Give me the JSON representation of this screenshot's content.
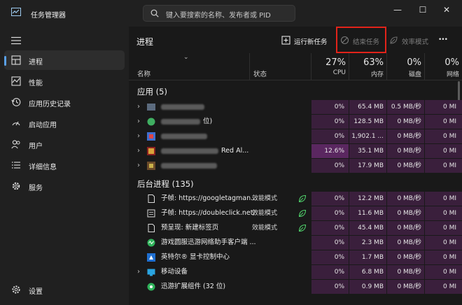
{
  "window": {
    "title": "任务管理器",
    "search_placeholder": "键入要搜索的名称、发布者或 PID",
    "controls": {
      "minimize": "—",
      "maximize": "☐",
      "close": "✕"
    }
  },
  "sidebar": {
    "items": [
      {
        "label": "进程",
        "icon": "processes-icon",
        "active": true
      },
      {
        "label": "性能",
        "icon": "performance-icon"
      },
      {
        "label": "应用历史记录",
        "icon": "app-history-icon"
      },
      {
        "label": "启动应用",
        "icon": "startup-icon"
      },
      {
        "label": "用户",
        "icon": "users-icon"
      },
      {
        "label": "详细信息",
        "icon": "details-icon"
      },
      {
        "label": "服务",
        "icon": "services-icon"
      }
    ],
    "settings_label": "设置"
  },
  "toolbar": {
    "title": "进程",
    "run_new_task": "运行新任务",
    "end_task": "结束任务",
    "efficiency_mode": "效率模式",
    "more": "•••"
  },
  "columns": {
    "name": "名称",
    "status": "状态",
    "cpu_pct": "27%",
    "cpu_label": "CPU",
    "mem_pct": "63%",
    "mem_label": "内存",
    "disk_pct": "0%",
    "disk_label": "磁盘",
    "net_pct": "0%",
    "net_label": "网络"
  },
  "sections": {
    "apps": "应用 (5)",
    "background": "后台进程 (135)"
  },
  "apps": [
    {
      "name": "",
      "cpu": "0%",
      "mem": "65.4 MB",
      "disk": "0.5 MB/秒",
      "net": "0 MI"
    },
    {
      "name": "位)",
      "cpu": "0%",
      "mem": "128.5 MB",
      "disk": "0 MB/秒",
      "net": "0 MI"
    },
    {
      "name": "",
      "cpu": "0%",
      "mem": "1,902.1 ...",
      "disk": "0 MB/秒",
      "net": "0 MI"
    },
    {
      "name": "Red Al...",
      "cpu": "12.6%",
      "mem": "35.1 MB",
      "disk": "0 MB/秒",
      "net": "0 MI"
    },
    {
      "name": "",
      "cpu": "0%",
      "mem": "17.9 MB",
      "disk": "0 MB/秒",
      "net": "0 MI"
    }
  ],
  "background": [
    {
      "name": "子帧: https://googletagman...",
      "status": "效能模式",
      "cpu": "0%",
      "mem": "12.2 MB",
      "disk": "0 MB/秒",
      "net": "0 MI"
    },
    {
      "name": "子帧: https://doubleclick.net/",
      "status": "效能模式",
      "cpu": "0%",
      "mem": "11.6 MB",
      "disk": "0 MB/秒",
      "net": "0 MI"
    },
    {
      "name": "预呈现: 新建标签页",
      "status": "效能模式",
      "cpu": "0%",
      "mem": "45.4 MB",
      "disk": "0 MB/秒",
      "net": "0 MI"
    },
    {
      "name": "游戏圆服迅游网络助手客户端 ...",
      "status": "",
      "cpu": "0%",
      "mem": "2.3 MB",
      "disk": "0 MB/秒",
      "net": "0 MI"
    },
    {
      "name": "英特尔® 显卡控制中心",
      "status": "",
      "cpu": "0%",
      "mem": "1.7 MB",
      "disk": "0 MB/秒",
      "net": "0 MI"
    },
    {
      "name": "移动设备",
      "status": "",
      "cpu": "0%",
      "mem": "6.8 MB",
      "disk": "0 MB/秒",
      "net": "0 MI"
    },
    {
      "name": "迅游扩展组件 (32 位)",
      "status": "",
      "cpu": "0%",
      "mem": "0.9 MB",
      "disk": "0 MB/秒",
      "net": "0 MI"
    }
  ],
  "colors": {
    "accent": "#5aa0e6",
    "tint": "#3a1f3c",
    "hot": "#5a2760",
    "highlight_box": "#e2231a"
  }
}
